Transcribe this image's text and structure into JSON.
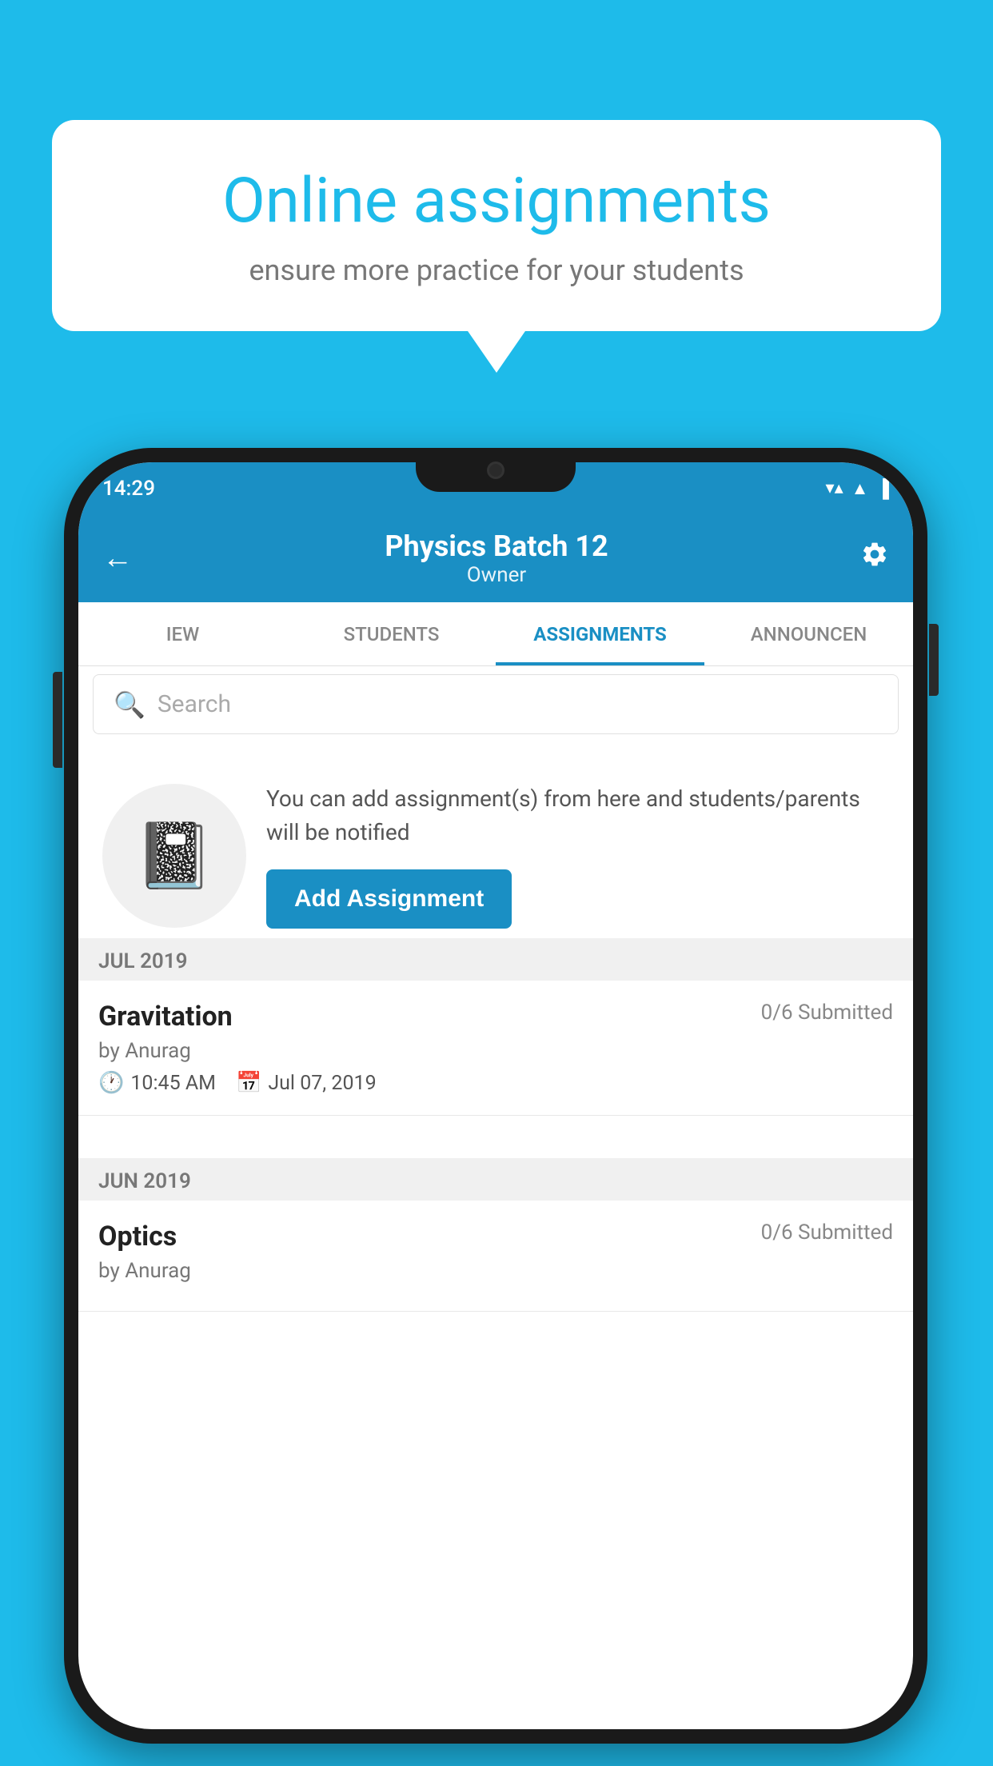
{
  "background_color": "#1EBBEA",
  "speech_bubble": {
    "title": "Online assignments",
    "subtitle": "ensure more practice for your students"
  },
  "phone": {
    "status_bar": {
      "time": "14:29",
      "wifi": "▼",
      "signal": "▲",
      "battery": "▐"
    },
    "header": {
      "title": "Physics Batch 12",
      "subtitle": "Owner",
      "back_label": "←",
      "settings_label": "⚙"
    },
    "tabs": [
      {
        "label": "IEW",
        "active": false
      },
      {
        "label": "STUDENTS",
        "active": false
      },
      {
        "label": "ASSIGNMENTS",
        "active": true
      },
      {
        "label": "ANNOUNCEN",
        "active": false
      }
    ],
    "search": {
      "placeholder": "Search"
    },
    "empty_state": {
      "description": "You can add assignment(s) from here and students/parents will be notified",
      "button_label": "Add Assignment"
    },
    "sections": [
      {
        "month": "JUL 2019",
        "assignments": [
          {
            "name": "Gravitation",
            "submitted": "0/6 Submitted",
            "author": "by Anurag",
            "time": "10:45 AM",
            "date": "Jul 07, 2019"
          }
        ]
      },
      {
        "month": "JUN 2019",
        "assignments": [
          {
            "name": "Optics",
            "submitted": "0/6 Submitted",
            "author": "by Anurag",
            "time": "",
            "date": ""
          }
        ]
      }
    ]
  }
}
